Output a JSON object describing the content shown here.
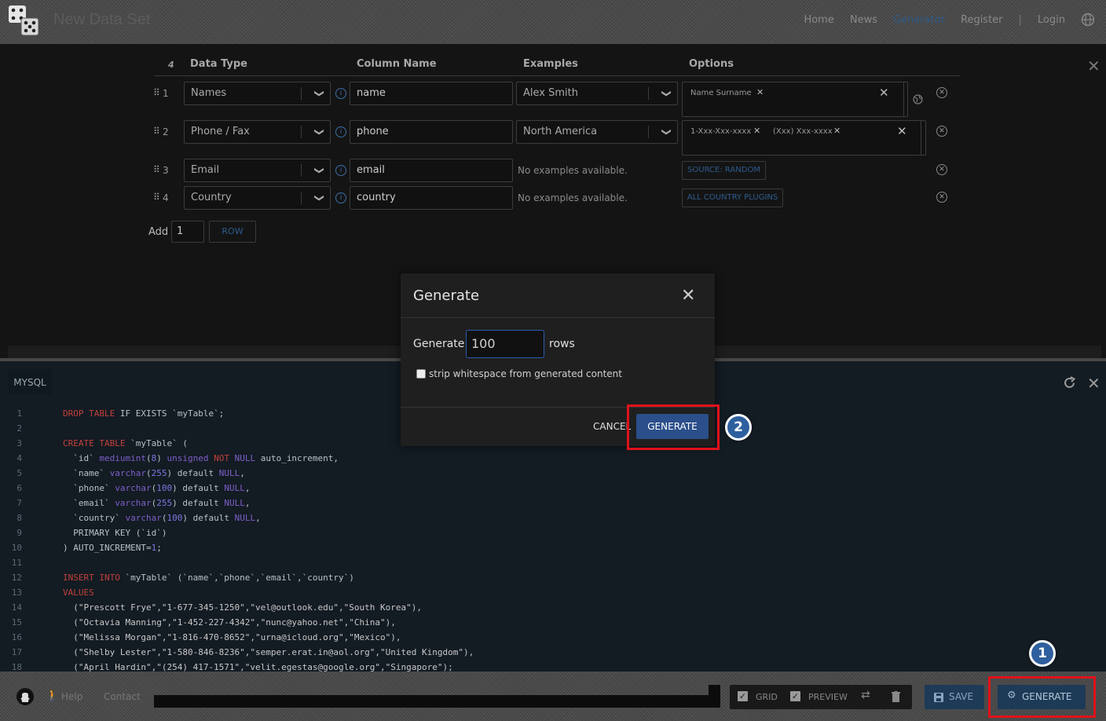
{
  "header": {
    "app_title": "New Data Set",
    "nav": [
      "Home",
      "News",
      "Generator",
      "Register",
      "|",
      "Login"
    ],
    "active_nav": "Generator"
  },
  "grid": {
    "row_count_label": "4",
    "columns": [
      "Data Type",
      "Column Name",
      "Examples",
      "Options"
    ],
    "rows": [
      {
        "num": "1",
        "type": "Names",
        "name": "name",
        "example": "Alex Smith",
        "options": [
          "Name Surname"
        ]
      },
      {
        "num": "2",
        "type": "Phone / Fax",
        "name": "phone",
        "example": "North America",
        "options": [
          "1-Xxx-Xxx-xxxx",
          "(Xxx) Xxx-xxxx"
        ]
      },
      {
        "num": "3",
        "type": "Email",
        "name": "email",
        "example": "No examples available.",
        "option_button": "SOURCE: RANDOM"
      },
      {
        "num": "4",
        "type": "Country",
        "name": "country",
        "example": "No examples available.",
        "option_button": "ALL COUNTRY PLUGINS"
      }
    ],
    "add_label": "Add",
    "add_value": "1",
    "row_button": "ROW"
  },
  "code": {
    "language": "MYSQL",
    "line_numbers": [
      "1",
      "2",
      "3",
      "4",
      "5",
      "6",
      "7",
      "8",
      "9",
      "10",
      "11",
      "12",
      "13",
      "14",
      "15",
      "16",
      "17",
      "18"
    ]
  },
  "modal": {
    "title": "Generate",
    "generate_label": "Generate",
    "rows_value": "100",
    "rows_label": "rows",
    "strip_label": "strip whitespace from generated content",
    "cancel_label": "CANCEL",
    "generate_button": "GENERATE"
  },
  "footer": {
    "help": "Help",
    "contact": "Contact",
    "grid_label": "GRID",
    "preview_label": "PREVIEW",
    "save_label": "SAVE",
    "generate_label": "GENERATE"
  },
  "annotations": {
    "badge1": "1",
    "badge2": "2"
  },
  "colors": {
    "accent": "#2e5f9e",
    "highlight": "#e0121a"
  }
}
